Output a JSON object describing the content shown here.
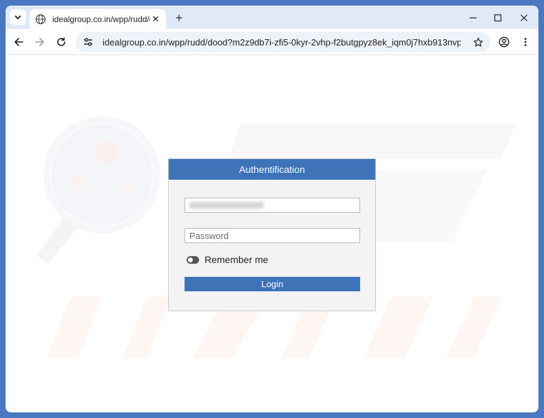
{
  "browser": {
    "tab": {
      "title": "idealgroup.co.in/wpp/rudd/dood",
      "close_glyph": "✕"
    },
    "new_tab_glyph": "+",
    "address_bar": {
      "url": "idealgroup.co.in/wpp/rudd/dood?m2z9db7i-zfi5-0kyr-2vhp-f2butgpyz8ek_iqm0j7hxb913nvpdz45..."
    },
    "icons": {
      "tab_search": "chevron-down-icon",
      "favicon": "globe-icon",
      "back": "arrow-left-icon",
      "forward": "arrow-right-icon",
      "reload": "reload-icon",
      "site_info": "tune-icon",
      "bookmark": "star-icon",
      "profile": "account-icon",
      "menu": "kebab-menu-icon",
      "minimize": "minimize-icon",
      "maximize": "maximize-icon",
      "close": "close-icon"
    }
  },
  "login_form": {
    "title": "Authentification",
    "username_value": "",
    "password_placeholder": "Password",
    "remember_label": "Remember me",
    "login_label": "Login"
  },
  "colors": {
    "accent": "#3f73b8",
    "titlebar": "#dfe9f8",
    "desktop": "#4a79c4"
  }
}
